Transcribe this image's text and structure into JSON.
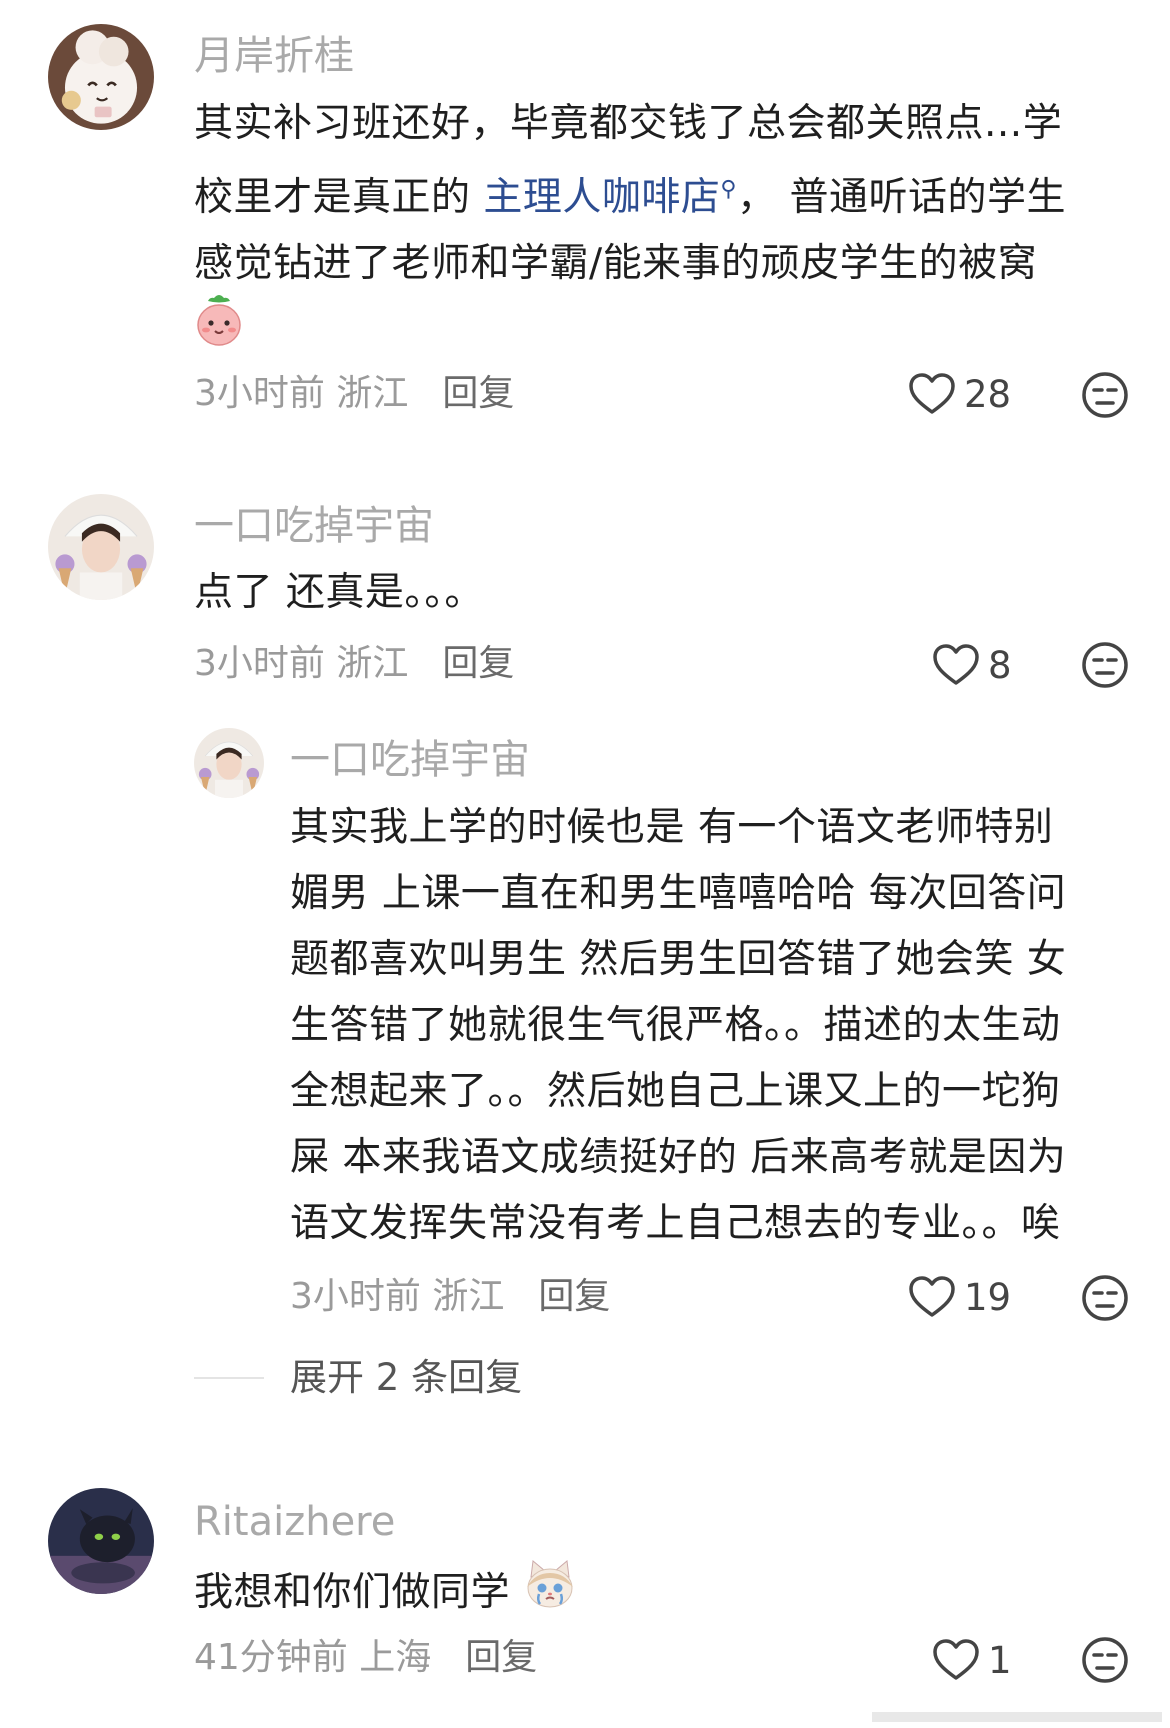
{
  "comments": [
    {
      "username": "月岸折桂",
      "text_line1": "其实补习班还好，毕竟都交钱了总会都关照点...学",
      "text_line2_pre": "校里才是真正的 ",
      "text_line2_link": "主理人咖啡店",
      "text_line2_post": "， 普通听话的学生",
      "text_line3": "感觉钻进了老师和学霸/能来事的顽皮学生的被窝",
      "time": "3小时前 浙江",
      "reply_label": "回复",
      "likes": "28"
    },
    {
      "username": "一口吃掉宇宙",
      "text": "点了 还真是。。。",
      "time": "3小时前 浙江",
      "reply_label": "回复",
      "likes": "8"
    },
    {
      "username": "一口吃掉宇宙",
      "lines": [
        "其实我上学的时候也是 有一个语文老师特别",
        "媚男 上课一直在和男生嘻嘻哈哈 每次回答问",
        "题都喜欢叫男生 然后男生回答错了她会笑 女",
        "生答错了她就很生气很严格。。描述的太生动",
        "全想起来了。。然后她自己上课又上的一坨狗",
        "屎 本来我语文成绩挺好的 后来高考就是因为",
        "语文发挥失常没有考上自己想去的专业。。唉"
      ],
      "time": "3小时前 浙江",
      "reply_label": "回复",
      "likes": "19"
    },
    {
      "username": "Ritaizhere",
      "text": "我想和你们做同学",
      "time": "41分钟前 上海",
      "reply_label": "回复",
      "likes": "1"
    }
  ],
  "expand_replies": "展开 2 条回复",
  "icons": {
    "like": "heart-outline-icon",
    "dislike": "unamused-face-icon",
    "search": "search-icon"
  }
}
